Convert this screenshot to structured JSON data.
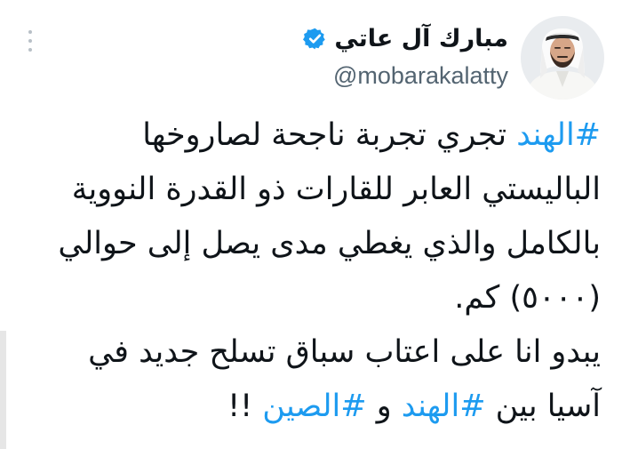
{
  "author": {
    "display_name": "مبارك آل عاتي",
    "handle": "@mobarakalatty",
    "verified": true,
    "avatar": "avatar-photo"
  },
  "icons": {
    "more": "more-vertical-icon",
    "verified": "verified-badge-icon"
  },
  "colors": {
    "hashtag": "#1d9bf0",
    "verified": "#1d9bf0",
    "text": "#0f1419",
    "secondary": "#536471"
  },
  "tweet": {
    "line1": {
      "hashtag": "#الهند",
      "text": " تجري تجربة ناجحة لصاروخها"
    },
    "line2": {
      "text": "الباليستي العابر للقارات ذو القدرة النووية"
    },
    "line3": {
      "text": "بالكامل والذي يغطي مدى يصل إلى حوالي"
    },
    "line4": {
      "text": "(٥٠٠٠) كم."
    },
    "line5": {
      "text": "يبدو انا على اعتاب سباق تسلح جديد في"
    },
    "line6": {
      "text_before": "آسيا بين ",
      "hashtag1": "#الهند",
      "conj": " و ",
      "hashtag2": "#الصين",
      "text_after": " !!"
    }
  }
}
